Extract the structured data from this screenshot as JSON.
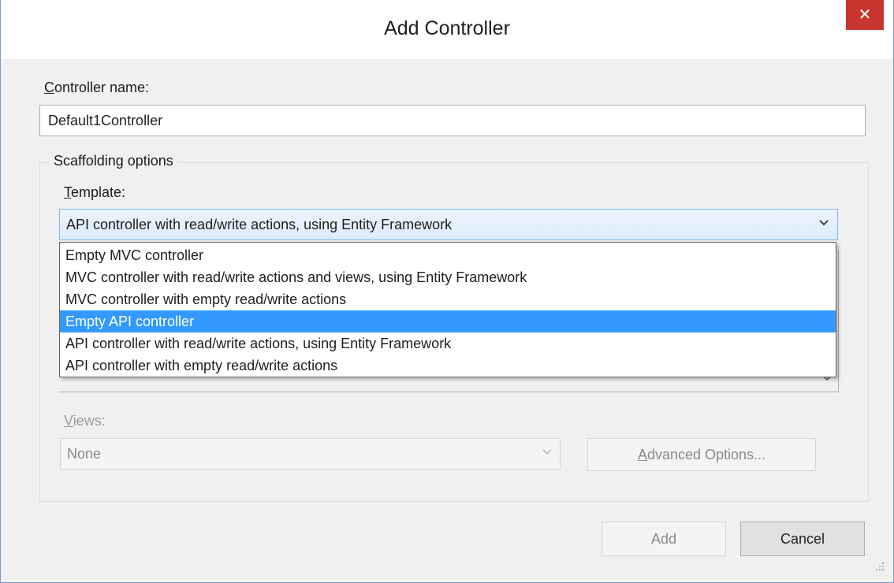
{
  "window": {
    "title": "Add Controller",
    "close_glyph": "✕"
  },
  "controller_name": {
    "label": "Controller name:",
    "label_mnemonic": "C",
    "label_rest": "ontroller name:",
    "value": "Default1Controller"
  },
  "scaffolding": {
    "legend": "Scaffolding options",
    "template": {
      "label_mnemonic": "T",
      "label_rest": "emplate:",
      "selected": "API controller with read/write actions, using Entity Framework",
      "options": [
        "Empty MVC controller",
        "MVC controller with read/write actions and views, using Entity Framework",
        "MVC controller with empty read/write actions",
        "Empty API controller",
        "API controller with read/write actions, using Entity Framework",
        "API controller with empty read/write actions"
      ],
      "highlighted_index": 3
    },
    "views": {
      "label_mnemonic": "V",
      "label_rest": "iews:",
      "selected": "None"
    },
    "advanced_button": {
      "mnemonic": "A",
      "rest": "dvanced Options..."
    }
  },
  "buttons": {
    "add": "Add",
    "cancel": "Cancel"
  },
  "icons": {
    "chevron": "chevron-down-icon",
    "close": "close-icon",
    "grip": "resize-grip-icon"
  },
  "colors": {
    "selection": "#3399ff",
    "close_button": "#c7362e"
  }
}
